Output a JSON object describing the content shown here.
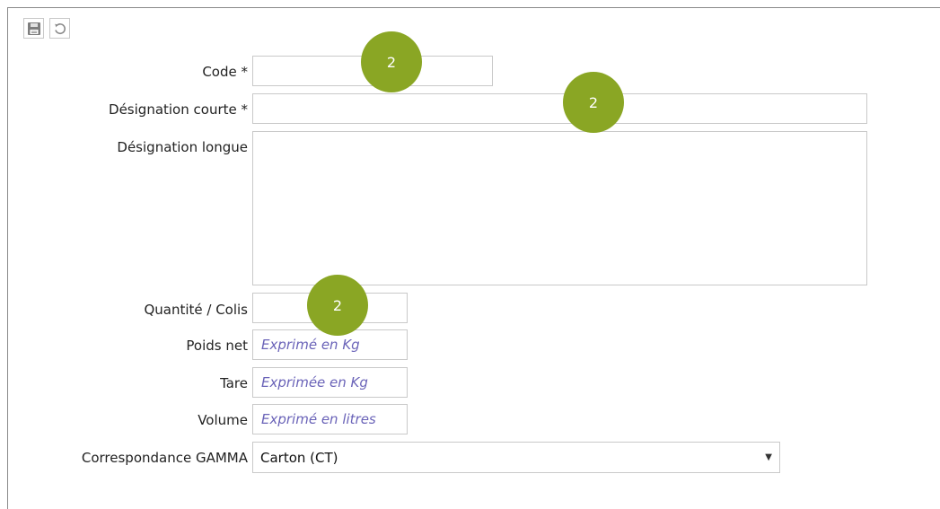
{
  "toolbar": {
    "save_icon": "save-icon",
    "undo_icon": "undo-icon"
  },
  "form": {
    "code": {
      "label": "Code *",
      "value": ""
    },
    "short_designation": {
      "label": "Désignation courte *",
      "value": ""
    },
    "long_designation": {
      "label": "Désignation longue",
      "value": ""
    },
    "quantity": {
      "label": "Quantité / Colis",
      "value": ""
    },
    "net_weight": {
      "label": "Poids net",
      "placeholder": "Exprimé en Kg"
    },
    "tare": {
      "label": "Tare",
      "placeholder": "Exprimée en Kg"
    },
    "volume": {
      "label": "Volume",
      "placeholder": "Exprimé en litres"
    },
    "gamma": {
      "label": "Correspondance GAMMA",
      "selected": "Carton (CT)"
    }
  },
  "badges": [
    "2",
    "2",
    "2"
  ],
  "colors": {
    "badge": "#8aa624",
    "placeholder": "#6a63b8",
    "border": "#c9c9c9"
  }
}
